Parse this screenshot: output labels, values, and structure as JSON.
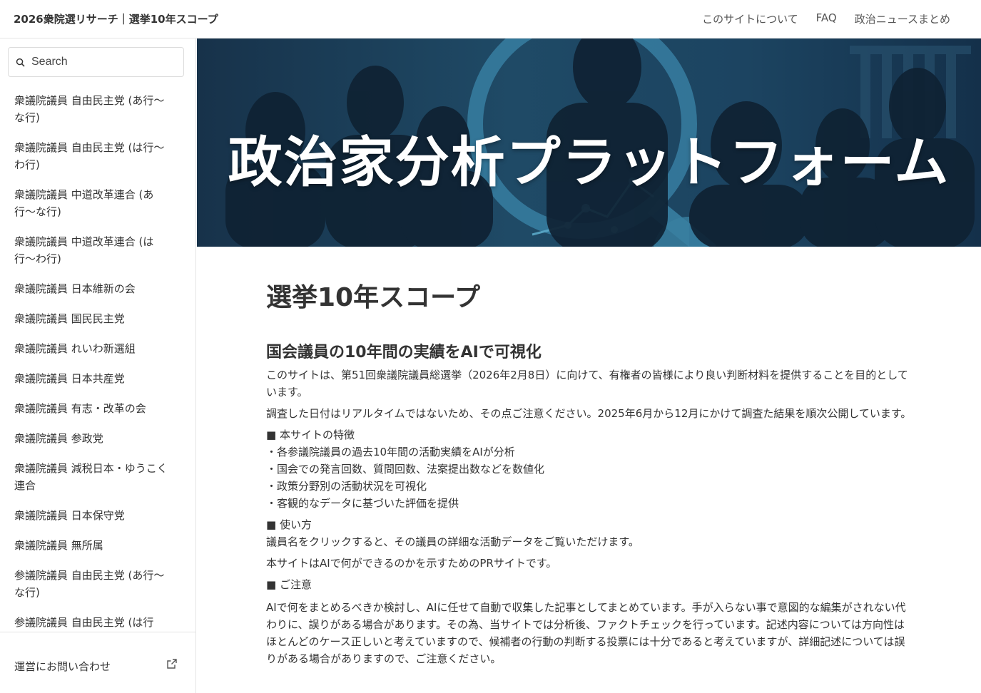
{
  "header": {
    "site_title": "2026衆院選リサーチ｜選挙10年スコープ",
    "nav": [
      "このサイトについて",
      "FAQ",
      "政治ニュースまとめ"
    ]
  },
  "sidebar": {
    "search_placeholder": "Search",
    "items": [
      "衆議院議員 自由民主党 (あ行〜な行)",
      "衆議院議員 自由民主党 (は行〜わ行)",
      "衆議院議員 中道改革連合 (あ行〜な行)",
      "衆議院議員 中道改革連合 (は行〜わ行)",
      "衆議院議員 日本維新の会",
      "衆議院議員 国民民主党",
      "衆議院議員 れいわ新選組",
      "衆議院議員 日本共産党",
      "衆議院議員 有志・改革の会",
      "衆議院議員 参政党",
      "衆議院議員 減税日本・ゆうこく連合",
      "衆議院議員 日本保守党",
      "衆議院議員 無所属",
      "参議院議員 自由民主党 (あ行〜な行)",
      "参議院議員 自由民主党 (は行"
    ],
    "footer_link": "運営にお問い合わせ"
  },
  "hero": {
    "title": "政治家分析プラットフォーム"
  },
  "main": {
    "page_title": "選挙10年スコープ",
    "section_title": "国会議員の10年間の実績をAIで可視化",
    "intro_1": "このサイトは、第51回衆議院議員総選挙（2026年2月8日）に向けて、有権者の皆様により良い判断材料を提供することを目的としています。",
    "intro_2": "調査した日付はリアルタイムではないため、その点ご注意ください。2025年6月から12月にかけて調査た結果を順次公開しています。",
    "features_heading": "■ 本サイトの特徴",
    "features": [
      "・各参議院議員の過去10年間の活動実績をAIが分析",
      "・国会での発言回数、質問回数、法案提出数などを数値化",
      "・政策分野別の活動状況を可視化",
      "・客観的なデータに基づいた評価を提供"
    ],
    "usage_heading": "■ 使い方",
    "usage_text": "議員名をクリックすると、その議員の詳細な活動データをご覧いただけます。",
    "pr_text": "本サイトはAIで何ができるのかを示すためのPRサイトです。",
    "caution_heading": "■ ご注意",
    "caution_text": "AIで何をまとめるべきか検討し、AIに任せて自動で収集した記事としてまとめています。手が入らない事で意図的な編集がされない代わりに、誤りがある場合があります。その為、当サイトでは分析後、ファクトチェックを行っています。記述内容については方向性はほとんどのケース正しいと考えていますので、候補者の行動の判断する投票には十分であると考えていますが、詳細記述については誤りがある場合がありますので、ご注意ください。"
  },
  "colors": {
    "hero_bg": "#1c4461",
    "text": "#333333"
  }
}
